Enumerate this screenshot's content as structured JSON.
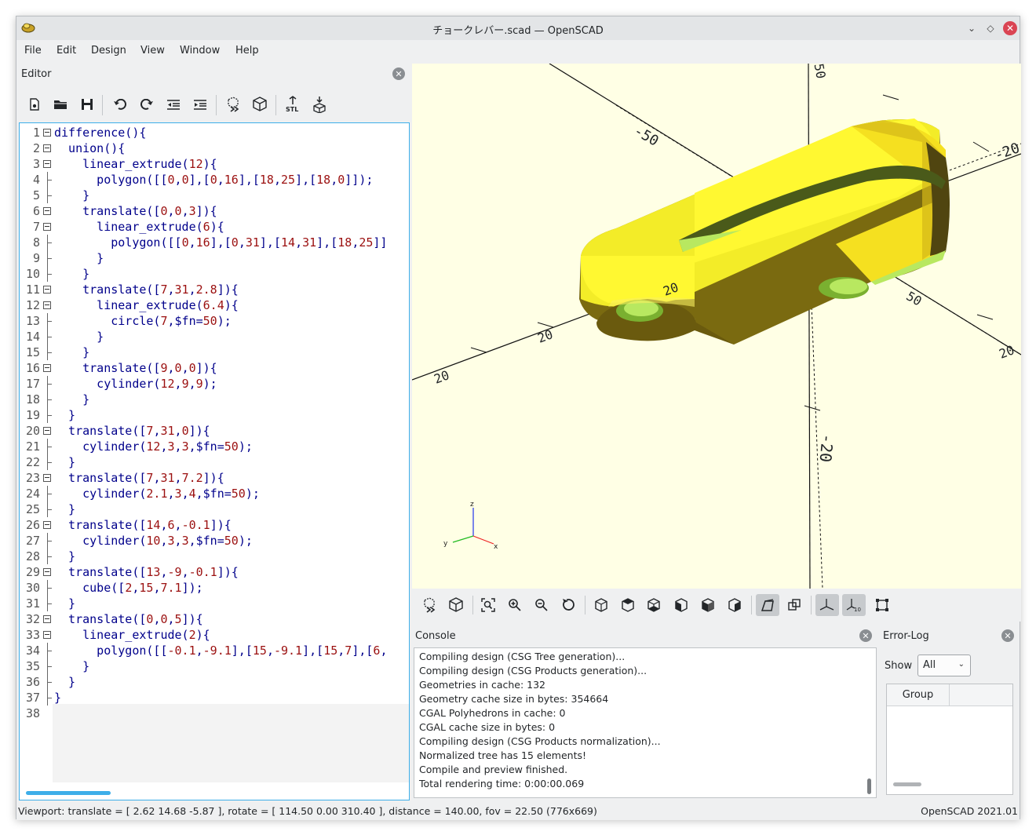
{
  "window": {
    "title": "チョークレバー.scad — OpenSCAD",
    "minimize_glyph": "⌄",
    "maximize_glyph": "◇",
    "close_glyph": "✕"
  },
  "menu": [
    "File",
    "Edit",
    "Design",
    "View",
    "Window",
    "Help"
  ],
  "editor": {
    "title": "Editor",
    "close_glyph": "✕",
    "toolbar": [
      {
        "name": "new-file-icon"
      },
      {
        "name": "open-file-icon"
      },
      {
        "name": "save-icon"
      },
      {
        "name": "undo-icon"
      },
      {
        "name": "redo-icon"
      },
      {
        "name": "unindent-icon"
      },
      {
        "name": "indent-icon"
      },
      {
        "name": "preview-icon"
      },
      {
        "name": "render-icon"
      },
      {
        "name": "export-stl-icon",
        "label": "STL"
      },
      {
        "name": "send-to-print-icon"
      }
    ],
    "lines": [
      {
        "n": "1",
        "t": "difference(){"
      },
      {
        "n": "2",
        "t": "  union(){"
      },
      {
        "n": "3",
        "t": "    linear_extrude(12){"
      },
      {
        "n": "4",
        "t": "      polygon([[0,0],[0,16],[18,25],[18,0]]);"
      },
      {
        "n": "5",
        "t": "    }"
      },
      {
        "n": "6",
        "t": "    translate([0,0,3]){"
      },
      {
        "n": "7",
        "t": "      linear_extrude(6){"
      },
      {
        "n": "8",
        "t": "        polygon([[0,16],[0,31],[14,31],[18,25]]"
      },
      {
        "n": "9",
        "t": "      }"
      },
      {
        "n": "10",
        "t": "    }"
      },
      {
        "n": "11",
        "t": "    translate([7,31,2.8]){"
      },
      {
        "n": "12",
        "t": "      linear_extrude(6.4){"
      },
      {
        "n": "13",
        "t": "        circle(7,$fn=50);"
      },
      {
        "n": "14",
        "t": "      }"
      },
      {
        "n": "15",
        "t": "    }"
      },
      {
        "n": "16",
        "t": "    translate([9,0,0]){"
      },
      {
        "n": "17",
        "t": "      cylinder(12,9,9);"
      },
      {
        "n": "18",
        "t": "    }"
      },
      {
        "n": "19",
        "t": "  }"
      },
      {
        "n": "20",
        "t": "  translate([7,31,0]){"
      },
      {
        "n": "21",
        "t": "    cylinder(12,3,3,$fn=50);"
      },
      {
        "n": "22",
        "t": "  }"
      },
      {
        "n": "23",
        "t": "  translate([7,31,7.2]){"
      },
      {
        "n": "24",
        "t": "    cylinder(2.1,3,4,$fn=50);"
      },
      {
        "n": "25",
        "t": "  }"
      },
      {
        "n": "26",
        "t": "  translate([14,6,-0.1]){"
      },
      {
        "n": "27",
        "t": "    cylinder(10,3,3,$fn=50);"
      },
      {
        "n": "28",
        "t": "  }"
      },
      {
        "n": "29",
        "t": "  translate([13,-9,-0.1]){"
      },
      {
        "n": "30",
        "t": "    cube([2,15,7.1]);"
      },
      {
        "n": "31",
        "t": "  }"
      },
      {
        "n": "32",
        "t": "  translate([0,0,5]){"
      },
      {
        "n": "33",
        "t": "    linear_extrude(2){"
      },
      {
        "n": "34",
        "t": "      polygon([[-0.1,-9.1],[15,-9.1],[15,7],[6,"
      },
      {
        "n": "35",
        "t": "    }"
      },
      {
        "n": "36",
        "t": "  }"
      },
      {
        "n": "37",
        "t": "}"
      },
      {
        "n": "38",
        "t": ""
      }
    ]
  },
  "viewport": {
    "background": "#ffffe5",
    "axis_labels": [
      "50",
      "20",
      "-50",
      "-20",
      "20",
      "50",
      "20",
      "-20"
    ],
    "gizmo": {
      "z": "z",
      "x": "x",
      "y": "y"
    }
  },
  "view_toolbar": [
    "preview-icon",
    "render-icon",
    "view-all-icon",
    "zoom-in-icon",
    "zoom-out-icon",
    "reset-view-icon",
    "view-right-icon",
    "view-top-icon",
    "view-bottom-icon",
    "view-left-icon",
    "view-front-icon",
    "view-back-icon",
    "perspective-icon",
    "orthogonal-icon",
    "show-axes-icon",
    "show-scale-icon",
    "show-edges-icon"
  ],
  "console": {
    "title": "Console",
    "close_glyph": "✕",
    "lines": [
      "Compiling design (CSG Tree generation)...",
      "Compiling design (CSG Products generation)...",
      "Geometries in cache: 132",
      "Geometry cache size in bytes: 354664",
      "CGAL Polyhedrons in cache: 0",
      "CGAL cache size in bytes: 0",
      "Compiling design (CSG Products normalization)...",
      "Normalized tree has 15 elements!",
      "Compile and preview finished.",
      "Total rendering time: 0:00:00.069"
    ]
  },
  "error_log": {
    "title": "Error-Log",
    "close_glyph": "✕",
    "show_label": "Show",
    "show_value": "All",
    "chevron_glyph": "⌄",
    "column": "Group"
  },
  "status": {
    "left": "Viewport: translate = [ 2.62 14.68 -5.87 ], rotate = [ 114.50 0.00 310.40 ], distance = 140.00, fov = 22.50 (776x669)",
    "right": "OpenSCAD 2021.01"
  }
}
